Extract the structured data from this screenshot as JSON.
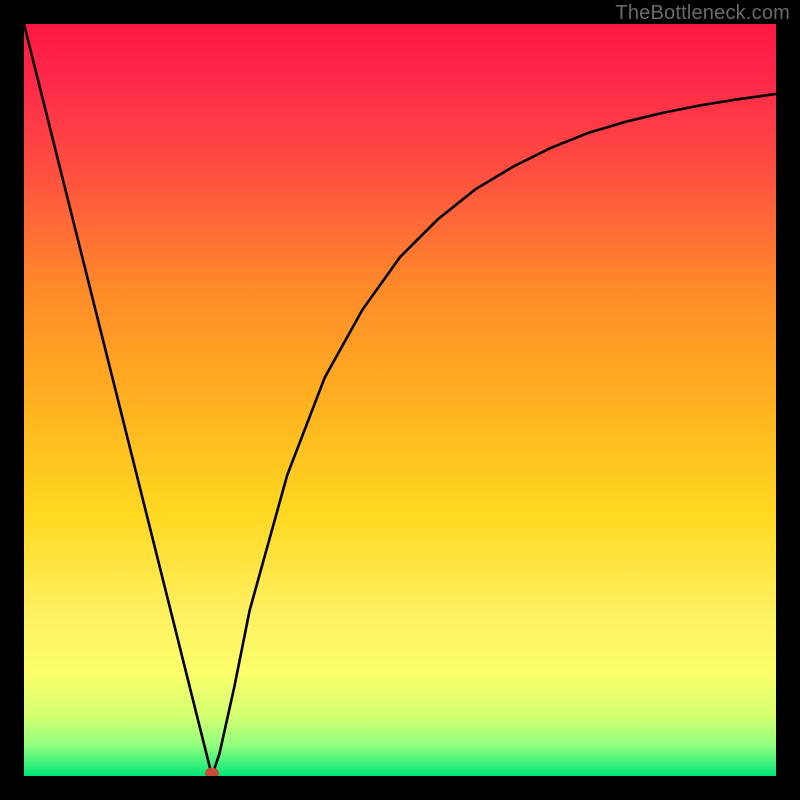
{
  "attribution": "TheBottleneck.com",
  "chart_data": {
    "type": "line",
    "title": "",
    "xlabel": "",
    "ylabel": "",
    "xlim": [
      0,
      100
    ],
    "ylim": [
      0,
      100
    ],
    "x": [
      0,
      5,
      10,
      15,
      20,
      22,
      24,
      25,
      26,
      28,
      30,
      35,
      40,
      45,
      50,
      55,
      60,
      65,
      70,
      75,
      80,
      85,
      90,
      95,
      100
    ],
    "values": [
      100,
      80,
      60,
      40,
      20,
      12,
      4,
      0,
      3,
      12,
      22,
      40,
      53,
      62,
      69,
      74,
      78,
      81,
      83.5,
      85.5,
      87,
      88.2,
      89.2,
      90,
      90.7
    ],
    "marker": {
      "x": 25,
      "y": 0
    },
    "gradient_stops": [
      {
        "pos": 0.0,
        "color": "#ff1744"
      },
      {
        "pos": 0.08,
        "color": "#ff2a4a"
      },
      {
        "pos": 0.2,
        "color": "#ff5040"
      },
      {
        "pos": 0.35,
        "color": "#ff8a2a"
      },
      {
        "pos": 0.5,
        "color": "#ffb020"
      },
      {
        "pos": 0.65,
        "color": "#ffd820"
      },
      {
        "pos": 0.78,
        "color": "#fff060"
      },
      {
        "pos": 0.86,
        "color": "#fcff6a"
      },
      {
        "pos": 0.92,
        "color": "#d4ff70"
      },
      {
        "pos": 0.96,
        "color": "#90ff80"
      },
      {
        "pos": 1.0,
        "color": "#00e676"
      }
    ]
  }
}
